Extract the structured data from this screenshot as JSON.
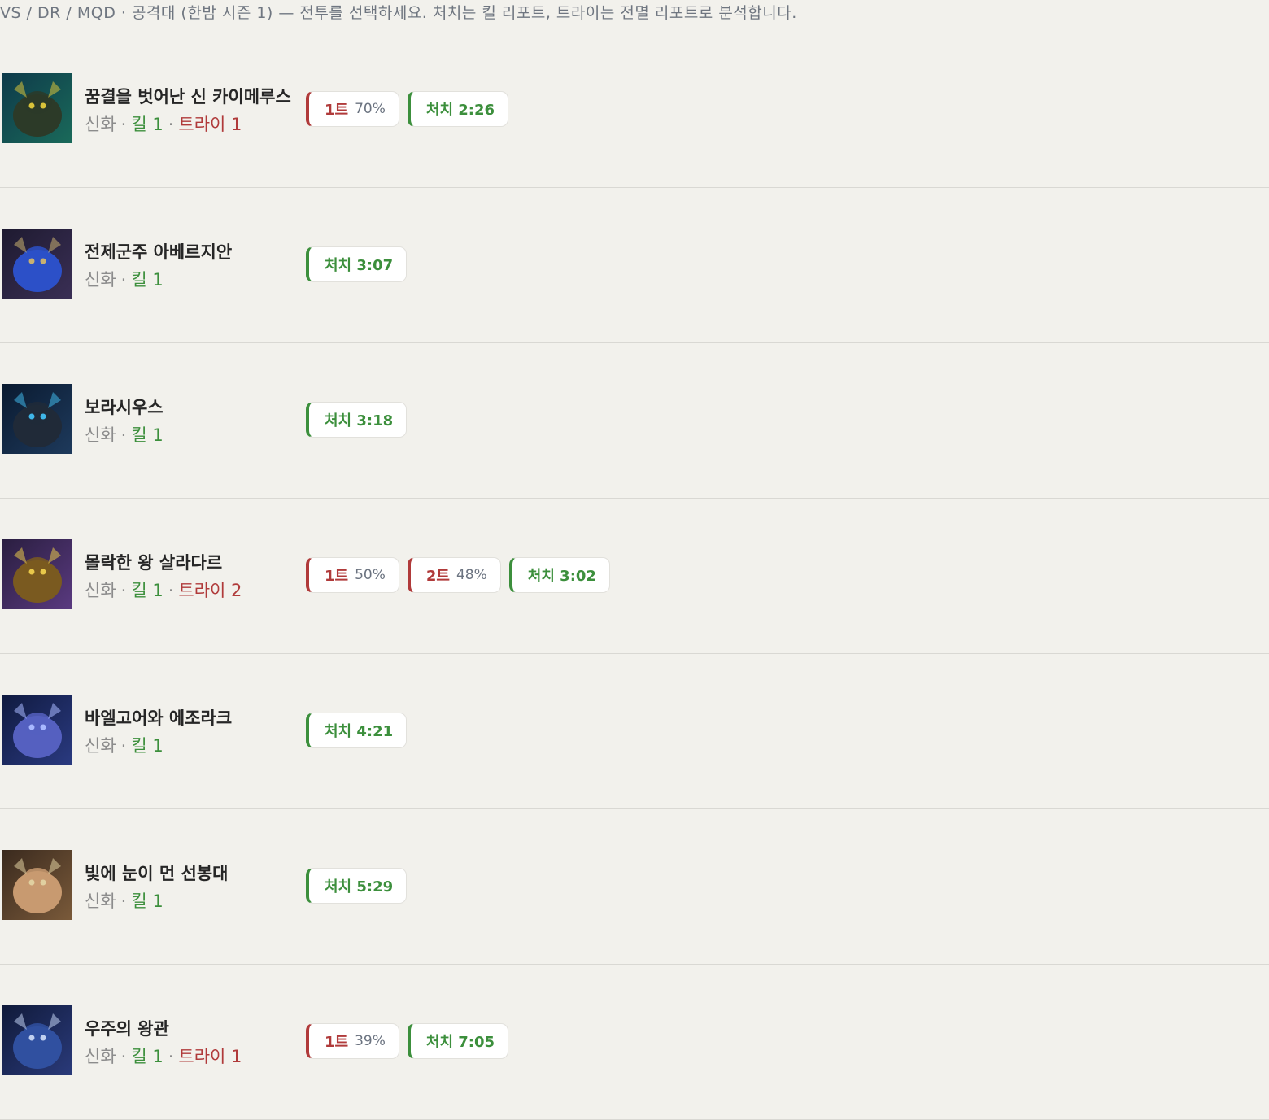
{
  "breadcrumb": "VS / DR / MQD · 공격대 (한밤 시즌 1) — 전투를 선택하세요. 처치는 킬 리포트, 트라이는 전멸 리포트로 분석합니다.",
  "colors": {
    "kill": "#3c8f3c",
    "try": "#b03a3a",
    "background": "#f2f1ec"
  },
  "separator": "·",
  "encounters": [
    {
      "name": "꿈결을 벗어난 신 카이메루스",
      "difficulty": "신화",
      "kill_text": "킬 1",
      "try_text": "트라이 1",
      "icon": "boss-portrait-chimaerus-icon",
      "tries": [
        {
          "label": "1트",
          "pct": "70%"
        }
      ],
      "kill_badge": "처치 2:26"
    },
    {
      "name": "전제군주 아베르지안",
      "difficulty": "신화",
      "kill_text": "킬 1",
      "try_text": "",
      "icon": "boss-portrait-averzian-icon",
      "tries": [],
      "kill_badge": "처치 3:07"
    },
    {
      "name": "보라시우스",
      "difficulty": "신화",
      "kill_text": "킬 1",
      "try_text": "",
      "icon": "boss-portrait-vorasius-icon",
      "tries": [],
      "kill_badge": "처치 3:18"
    },
    {
      "name": "몰락한 왕 살라다르",
      "difficulty": "신화",
      "kill_text": "킬 1",
      "try_text": "트라이 2",
      "icon": "boss-portrait-salhadaar-icon",
      "tries": [
        {
          "label": "1트",
          "pct": "50%"
        },
        {
          "label": "2트",
          "pct": "48%"
        }
      ],
      "kill_badge": "처치 3:02"
    },
    {
      "name": "바엘고어와 에조라크",
      "difficulty": "신화",
      "kill_text": "킬 1",
      "try_text": "",
      "icon": "boss-portrait-vaelgor-ezzorak-icon",
      "tries": [],
      "kill_badge": "처치 4:21"
    },
    {
      "name": "빛에 눈이 먼 선봉대",
      "difficulty": "신화",
      "kill_text": "킬 1",
      "try_text": "",
      "icon": "boss-portrait-vanguard-icon",
      "tries": [],
      "kill_badge": "처치 5:29"
    },
    {
      "name": "우주의 왕관",
      "difficulty": "신화",
      "kill_text": "킬 1",
      "try_text": "트라이 1",
      "icon": "boss-portrait-crown-icon",
      "tries": [
        {
          "label": "1트",
          "pct": "39%"
        }
      ],
      "kill_badge": "처치 7:05"
    }
  ]
}
